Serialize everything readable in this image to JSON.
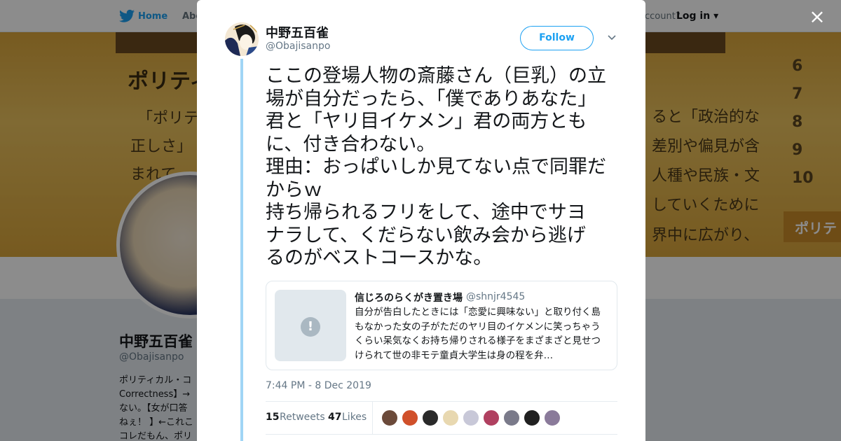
{
  "nav": {
    "home": "Home",
    "about": "Abo",
    "account_prompt": "ccount?",
    "login": "Log in"
  },
  "banner": {
    "heading": "ポリティ",
    "lines": [
      "「ポリテ",
      "正しさ」",
      "まれて",
      "ると「政治的な",
      "差別や偏見が含",
      "人種や民族・文",
      "していくために",
      "界中に広がり、"
    ],
    "numbers": [
      "6",
      "7",
      "8",
      "9",
      "10"
    ],
    "tab": "ポリテ"
  },
  "profile": {
    "name": "中野五百雀",
    "handle": "@Obajisanpo",
    "bio_lines": [
      "ポリティカル・コ",
      "Correctness】→",
      "ない。【女が口答",
      "ねぇ！ 】←これこ",
      "コレだもん、ポリ"
    ]
  },
  "modal": {
    "close": "×",
    "author": {
      "name": "中野五百雀",
      "handle": "@Obajisanpo"
    },
    "follow_label": "Follow",
    "tweet_text": "ここの登場人物の斎藤さん（巨乳）の立\n場が自分だったら、「僕でありあなた」\n君と「ヤリ目イケメン」君の両方とも\nに、付き合わない。\n理由：おっぱいしか見てない点で同罪だ\nからｗ\n持ち帰られるフリをして、途中でサヨ\nナラして、くだらない飲み会から逃げ\nるのがベストコースかな。",
    "quote": {
      "name": "信じろのらくがき置き場",
      "handle": "@shnjr4545",
      "text": "自分が告白したときには「恋愛に興味ない」と取り付く島もなかった女の子がただのヤリ目のイケメンに笑っちゃうくらい呆気なくお持ち帰りされる様子をまざまざと見せつけられて世の非モテ童貞大学生は身の程を弁…",
      "alert_glyph": "!"
    },
    "timestamp": "7:44 PM - 8 Dec 2019",
    "stats": {
      "retweets_count": "15",
      "retweets_label": "Retweets",
      "likes_count": "47",
      "likes_label": "Likes"
    },
    "liker_colors": [
      "#6b4a3a",
      "#d0502a",
      "#2a2a2a",
      "#e8d8b0",
      "#c8c8d8",
      "#b04060",
      "#7a7a8a",
      "#202020",
      "#8a7a9a"
    ]
  }
}
